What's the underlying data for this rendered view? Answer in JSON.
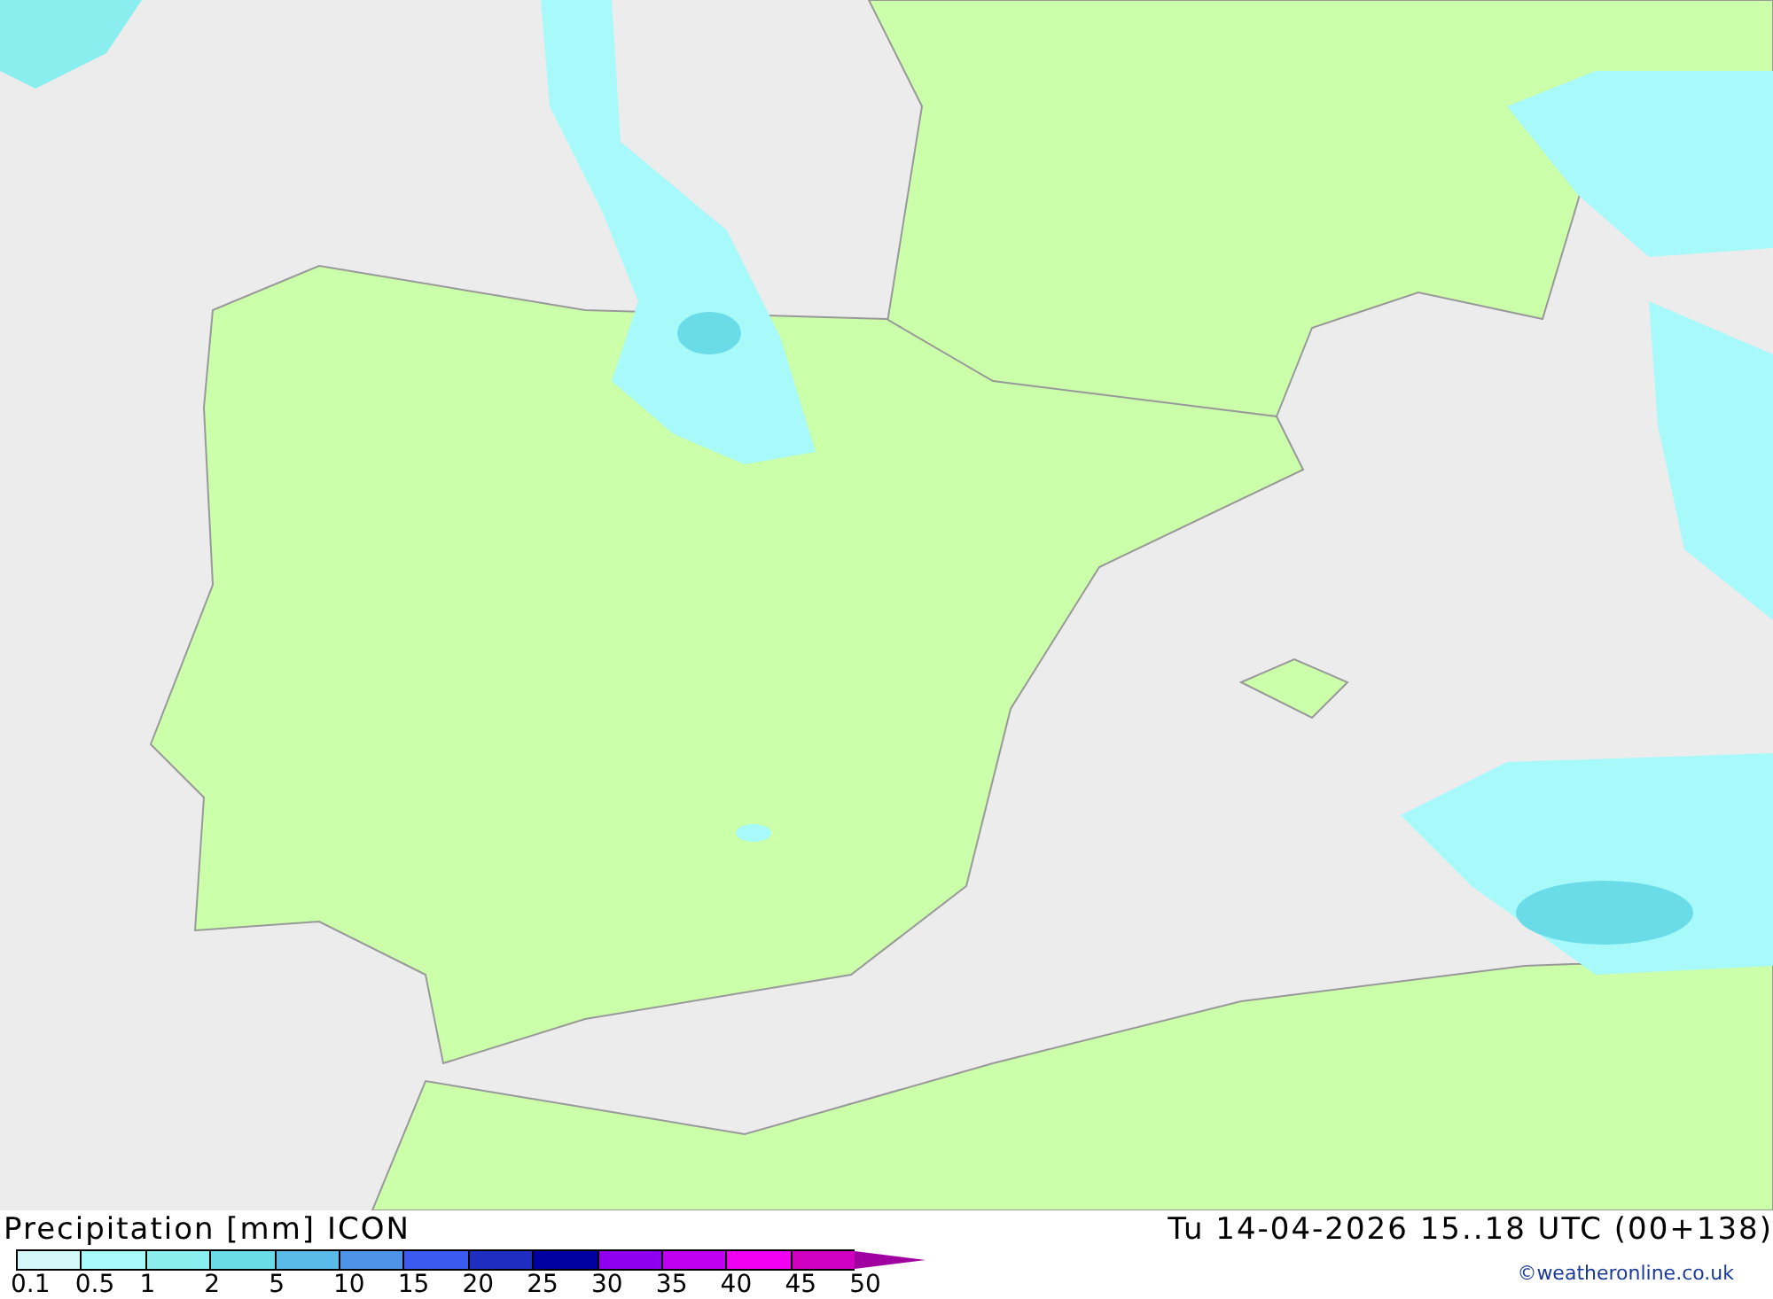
{
  "legend": {
    "title": "Precipitation [mm] ICON",
    "valid_time": "Tu 14-04-2026 15..18 UTC (00+138)",
    "credit": "©weatheronline.co.uk",
    "swatches": [
      {
        "color": "#d4f7f7"
      },
      {
        "color": "#a8fafa"
      },
      {
        "color": "#8aeeee"
      },
      {
        "color": "#6adce8"
      },
      {
        "color": "#5abbe8"
      },
      {
        "color": "#4f93e8"
      },
      {
        "color": "#3a5af0"
      },
      {
        "color": "#1e2ec0"
      },
      {
        "color": "#0000a0"
      },
      {
        "color": "#9000f0"
      },
      {
        "color": "#c000f0"
      },
      {
        "color": "#f000f0"
      },
      {
        "color": "#d000c0"
      },
      {
        "kind": "arrow",
        "color": "#a000a0"
      }
    ],
    "labels": [
      "0.1",
      "0.5",
      "1",
      "2",
      "5",
      "10",
      "15",
      "20",
      "25",
      "30",
      "35",
      "40",
      "45",
      "50"
    ]
  }
}
